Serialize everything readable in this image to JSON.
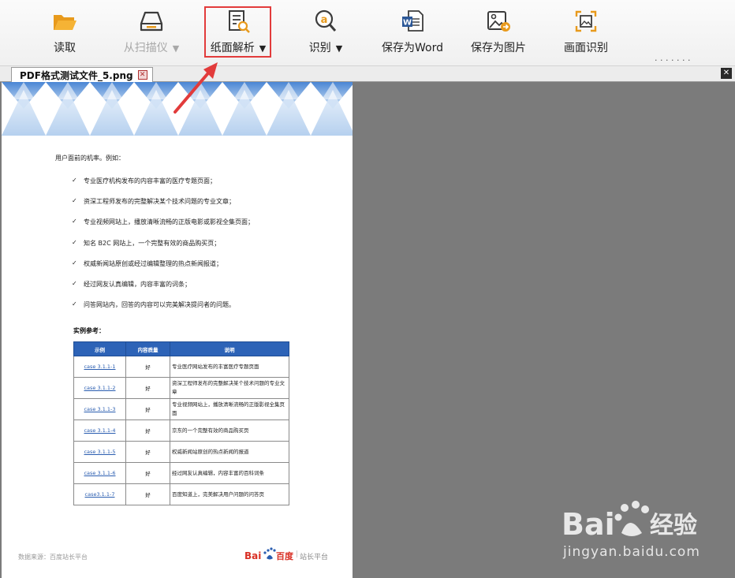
{
  "toolbar": {
    "read_label": "读取",
    "scan_label": "从扫描仪",
    "parse_label": "纸面解析",
    "recognize_label": "识别",
    "save_word_label": "保存为Word",
    "save_image_label": "保存为图片",
    "screen_recognize_label": "画面识别",
    "dropdown_glyph": "▼"
  },
  "tab": {
    "filename": "PDF格式测试文件_5.png",
    "close_glyph": "✕",
    "corner_close_glyph": "✕"
  },
  "document": {
    "intro": "用户面前的机率。例如：",
    "check_glyph": "✓",
    "bullets": [
      "专业医疗机构发布的内容丰富的医疗专题页面；",
      "资深工程师发布的完整解决某个技术问题的专业文章；",
      "专业视频网站上，播放清晰流畅的正版电影或影视全集页面；",
      "知名 B2C 网站上，一个完整有效的商品购买页；",
      "权威新闻站原创或经过编辑整理的热点新闻报道；",
      "经过网友认真编辑，内容丰富的词条；",
      "问答网站内，回答的内容可以完美解决提问者的问题。"
    ],
    "reference_title": "实例参考：",
    "table": {
      "headers": [
        "示例",
        "内容质量",
        "说明"
      ],
      "rows": [
        {
          "example": "case 3.1.1-1",
          "quality": "好",
          "desc": "专业医疗网站发布的丰富医疗专题页面"
        },
        {
          "example": "case 3.1.1-2",
          "quality": "好",
          "desc": "资深工程师发布的完整解决某个技术问题的专业文章"
        },
        {
          "example": "case 3.1.1-3",
          "quality": "好",
          "desc": "专业视频网站上，播放清晰流畅的正版影视全集页面"
        },
        {
          "example": "case 3.1.1-4",
          "quality": "好",
          "desc": "京东的一个完整有效的商品购买页"
        },
        {
          "example": "case 3.1.1-5",
          "quality": "好",
          "desc": "权威新闻站原创的热点新闻的报道"
        },
        {
          "example": "case 3.1.1-6",
          "quality": "好",
          "desc": "经过网友认真编辑，内容丰富的百科词条"
        },
        {
          "example": "case3.1.1-7",
          "quality": "好",
          "desc": "百度知道上，完美解决用户问题的问答页"
        }
      ]
    },
    "source": "数据来源：百度站长平台",
    "footer_logo_text": "Bai百度",
    "footer_separator": "|",
    "footer_site": "站长平台"
  },
  "watermark": {
    "brand": "Bai",
    "brand_suffix": "经验",
    "url": "jingyan.baidu.com"
  },
  "stray_text": "· · · · · · ·",
  "colors": {
    "highlight": "#e23b3b",
    "table_header": "#2d63b7",
    "viewer_bg": "#7b7b7b",
    "folder": "#f5a623",
    "word_blue": "#2b5797"
  }
}
